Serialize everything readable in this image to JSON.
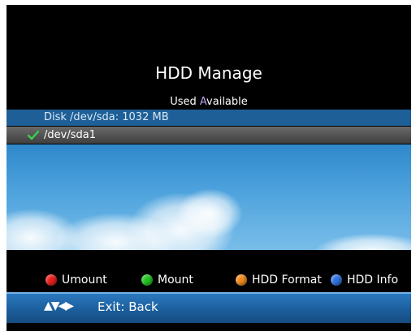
{
  "screen": {
    "title": "HDD Manage",
    "legend": {
      "used": "Used",
      "available_first": "A",
      "available_rest": "vailable"
    },
    "disk": {
      "label": "Disk /dev/sda: 1032 MB"
    },
    "partition": {
      "check": "✔",
      "label": "/dev/sda1"
    }
  },
  "actions": [
    {
      "label": "Umount",
      "color": "#e8201c"
    },
    {
      "label": "Mount",
      "color": "#22c21e"
    },
    {
      "label": "HDD Format",
      "color": "#f08a1e"
    },
    {
      "label": "HDD Info",
      "color": "#2f73e0"
    }
  ],
  "footer": {
    "arrows": "▲▼◀▶",
    "exit_label": "Exit: Back"
  }
}
